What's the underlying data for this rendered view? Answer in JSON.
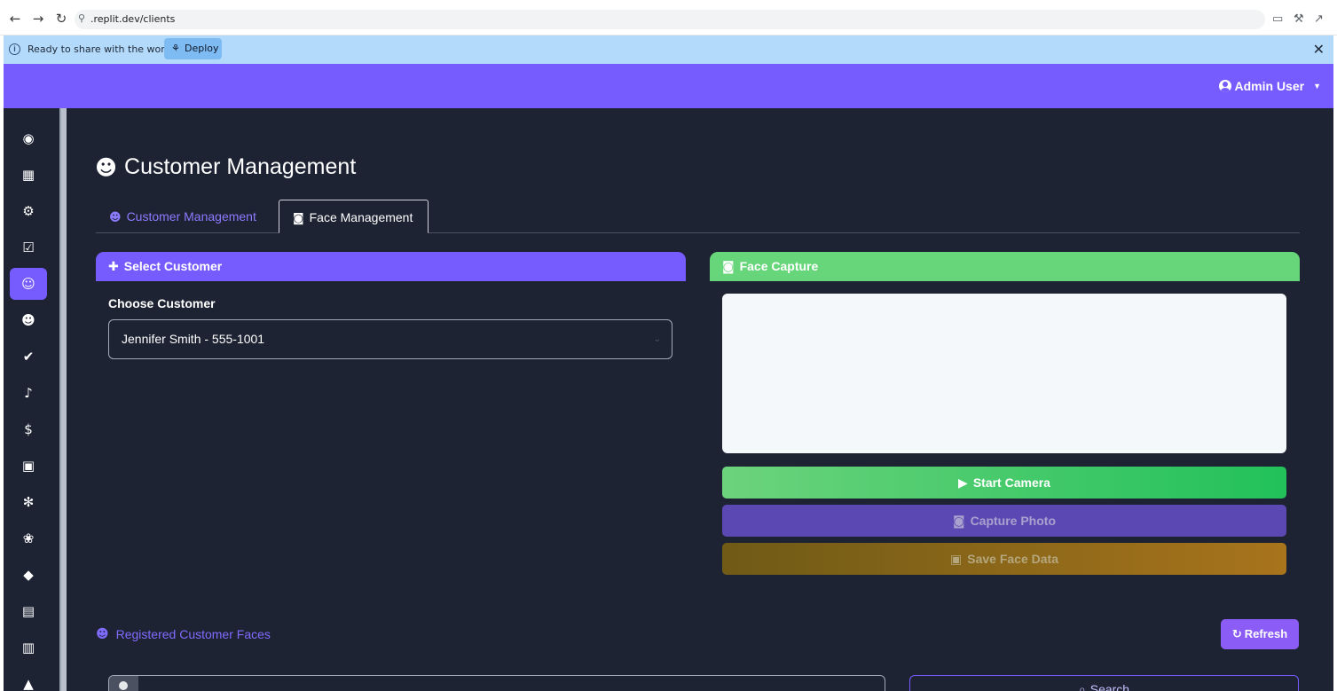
{
  "browser": {
    "url": ".replit.dev/clients",
    "back": "←",
    "forward": "→",
    "reload": "↻"
  },
  "banner": {
    "text": "Ready to share with the world?",
    "deploy_label": "Deploy",
    "close": "✕"
  },
  "topnav": {
    "user_label": "Admin User",
    "caret": "▼"
  },
  "sidebar": {
    "items": [
      {
        "name": "dashboard-icon",
        "glyph": "◉"
      },
      {
        "name": "calendar-icon",
        "glyph": "▦"
      },
      {
        "name": "users-cog-icon",
        "glyph": "⚙"
      },
      {
        "name": "calendar-check-icon",
        "glyph": "☑"
      },
      {
        "name": "users-icon",
        "glyph": "☺",
        "active": true
      },
      {
        "name": "users-group-icon",
        "glyph": "☻"
      },
      {
        "name": "user-check-icon",
        "glyph": "✔"
      },
      {
        "name": "bell-icon",
        "glyph": "♪"
      },
      {
        "name": "invoice-icon",
        "glyph": "$"
      },
      {
        "name": "boxes-icon",
        "glyph": "▣"
      },
      {
        "name": "cogs-icon",
        "glyph": "✻"
      },
      {
        "name": "spa-icon",
        "glyph": "❀"
      },
      {
        "name": "tags-icon",
        "glyph": "◆"
      },
      {
        "name": "chart-icon",
        "glyph": "▤"
      },
      {
        "name": "receipt-icon",
        "glyph": "▥"
      },
      {
        "name": "warning-icon",
        "glyph": "▲"
      }
    ]
  },
  "page": {
    "title": "Customer Management",
    "title_icon": "☻"
  },
  "tabs": [
    {
      "label": "Customer Management",
      "icon": "☻"
    },
    {
      "label": "Face Management",
      "icon": "◙"
    }
  ],
  "select_card": {
    "header": "Select Customer",
    "header_icon": "✚",
    "choose_label": "Choose Customer",
    "selected_value": "Jennifer Smith - 555-1001",
    "chevron": "⌄"
  },
  "face_card": {
    "header": "Face Capture",
    "header_icon": "◙",
    "start_camera": "Start Camera",
    "start_icon": "▶",
    "capture_photo": "Capture Photo",
    "capture_icon": "◙",
    "save_face": "Save Face Data",
    "save_icon": "▣"
  },
  "registered": {
    "title": "Registered Customer Faces",
    "title_icon": "☻",
    "refresh": "Refresh",
    "refresh_icon": "↻",
    "search_button": "Search",
    "search_icon": "⌕"
  },
  "colors": {
    "primary": "#765cff",
    "success": "#67d67a",
    "background": "#1d2333",
    "warning": "#a8741c"
  }
}
